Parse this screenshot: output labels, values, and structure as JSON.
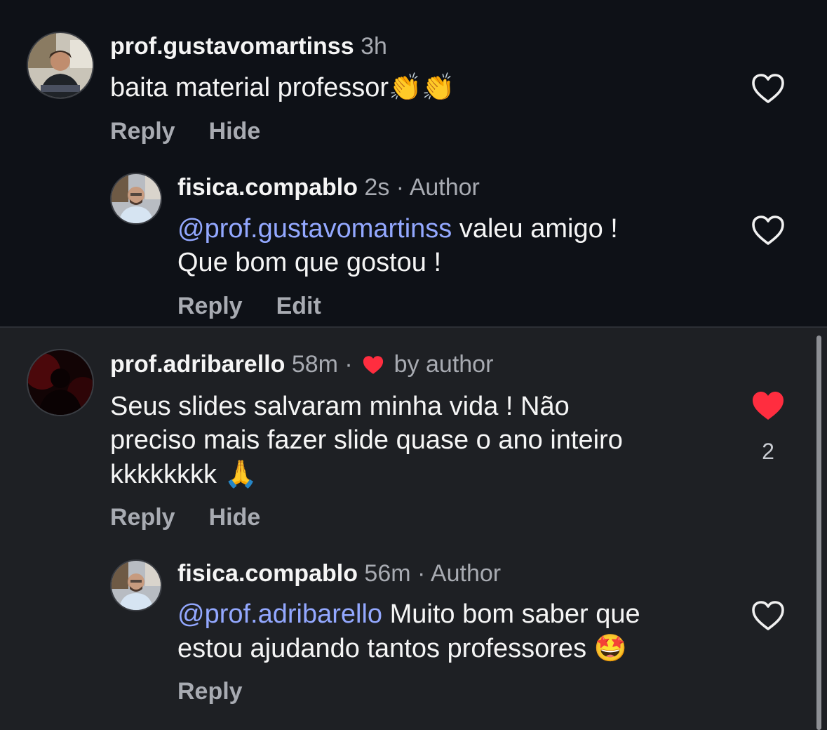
{
  "comments": [
    {
      "username": "prof.gustavomartinss",
      "time": "3h",
      "text": "baita material professor",
      "emoji": "👏👏",
      "actions": [
        "Reply",
        "Hide"
      ],
      "liked": false
    },
    {
      "username": "fisica.compablo",
      "time": "2s",
      "separator": "·",
      "tag": "Author",
      "mention": "@prof.gustavomartinss",
      "text_line1": " valeu amigo !",
      "text_line2": "Que bom que gostou !",
      "actions": [
        "Reply",
        "Edit"
      ],
      "liked": false
    },
    {
      "username": "prof.adribarello",
      "time": "58m",
      "separator": "·",
      "liked_by": "by author",
      "text_line1": "Seus slides salvaram minha vida ! Não",
      "text_line2": "preciso mais fazer slide quase o ano inteiro",
      "text_line3": "kkkkkkkk",
      "emoji": "🙏",
      "actions": [
        "Reply",
        "Hide"
      ],
      "liked": true,
      "like_count": "2"
    },
    {
      "username": "fisica.compablo",
      "time": "56m",
      "separator": "·",
      "tag": "Author",
      "mention": "@prof.adribarello",
      "text_line1": " Muito bom saber que",
      "text_line2": "estou ajudando tantos professores",
      "emoji": "🤩",
      "actions": [
        "Reply"
      ],
      "liked": false
    }
  ],
  "icons": {
    "like": "heart-outline-icon",
    "liked": "heart-filled-icon",
    "liked_by_author": "small-heart-icon"
  },
  "colors": {
    "top_background": "#0e1117",
    "bottom_background": "#1e2024",
    "mention": "#93a8ff",
    "heart_red": "#ff2d3f",
    "muted_text": "#a8abb2"
  }
}
